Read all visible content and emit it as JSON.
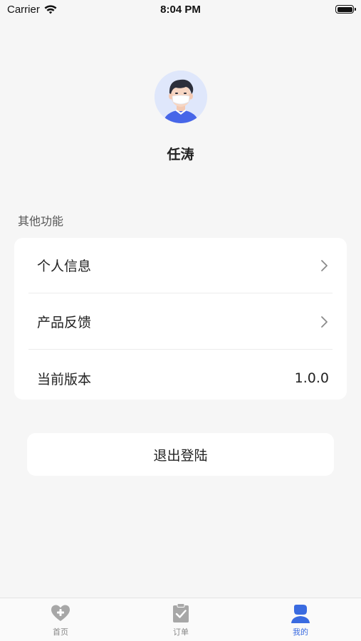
{
  "status_bar": {
    "carrier": "Carrier",
    "time": "8:04 PM"
  },
  "profile": {
    "name": "任涛",
    "avatar_icon": "masked-man-avatar"
  },
  "section": {
    "title": "其他功能"
  },
  "menu": {
    "items": [
      {
        "label": "个人信息",
        "trailing": "chevron-right-icon"
      },
      {
        "label": "产品反馈",
        "trailing": "chevron-right-icon"
      },
      {
        "label": "当前版本",
        "value": "1.0.0"
      }
    ]
  },
  "logout": {
    "label": "退出登陆"
  },
  "tab_bar": {
    "active_color": "#3a6be0",
    "inactive_color": "#a7a7a7",
    "tabs": [
      {
        "label": "首页",
        "icon": "heart-plus-icon",
        "active": false
      },
      {
        "label": "订单",
        "icon": "clipboard-check-icon",
        "active": false
      },
      {
        "label": "我的",
        "icon": "user-icon",
        "active": true
      }
    ]
  }
}
